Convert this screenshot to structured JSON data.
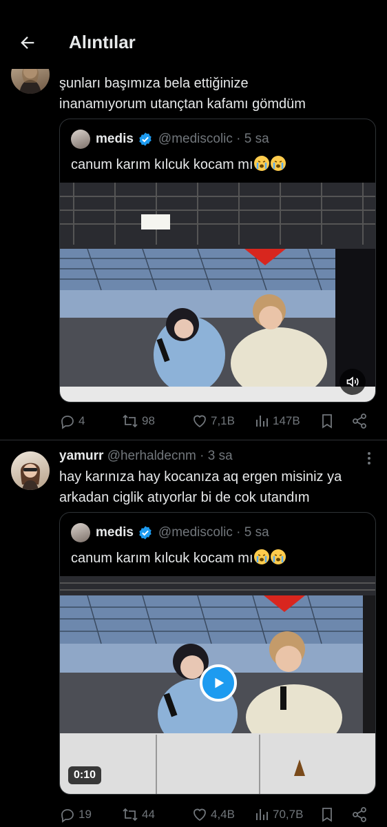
{
  "header": {
    "title": "Alıntılar"
  },
  "tweet1": {
    "text_line1": "şunları başımıza bela ettiğinize",
    "text_line2": "inanamıyorum utançtan kafamı gömdüm",
    "quote": {
      "name": "medis",
      "handle_time": "@mediscolic · 5 sa",
      "text": "canum karım kılcuk kocam mı"
    },
    "actions": {
      "replies": "4",
      "retweets": "98",
      "likes": "7,1B",
      "views": "147B"
    }
  },
  "tweet2": {
    "name": "yamurr",
    "handle_time": "@herhaldecnm · 3 sa",
    "text_line1": "hay karınıza hay kocanıza aq ergen misiniz ya",
    "text_line2": "arkadan ciglik atıyorlar bi de cok utandım",
    "quote": {
      "name": "medis",
      "handle_time": "@mediscolic · 5 sa",
      "text": "canum karım kılcuk kocam mı",
      "duration": "0:10"
    },
    "actions": {
      "replies": "19",
      "retweets": "44",
      "likes": "4,4B",
      "views": "70,7B"
    }
  },
  "colors": {
    "background": "#000000",
    "text": "#e7e9ea",
    "muted": "#71767b",
    "border": "#2f3336",
    "accent": "#1d9bf0"
  },
  "icons": [
    "back-arrow-icon",
    "verified-badge-icon",
    "reply-icon",
    "retweet-icon",
    "like-icon",
    "views-icon",
    "bookmark-icon",
    "share-icon",
    "sound-icon",
    "play-icon",
    "more-icon",
    "loudly-crying-emoji"
  ]
}
